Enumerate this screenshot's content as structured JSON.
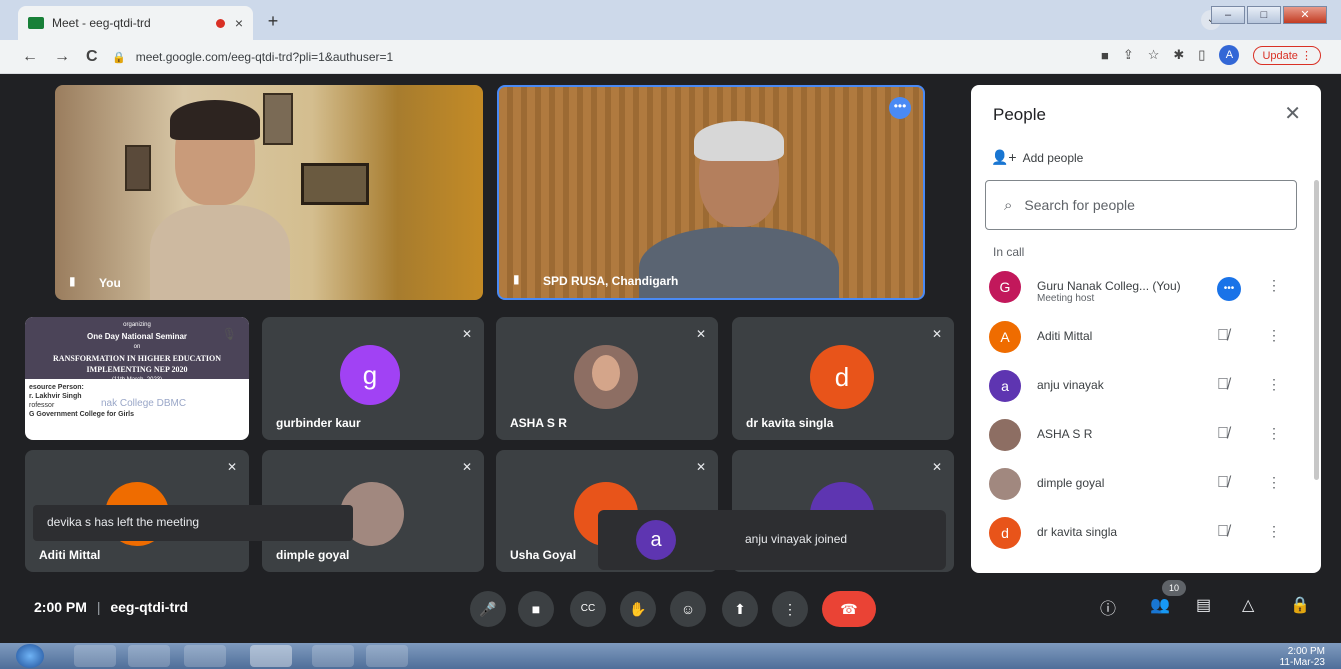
{
  "browser": {
    "tab_title": "Meet - eeg-qtdi-trd",
    "tab_close": "×",
    "new_tab": "+",
    "url": "meet.google.com/eeg-qtdi-trd?pli=1&authuser=1",
    "profile_letter": "A",
    "update_label": "Update",
    "nav": {
      "back": "←",
      "forward": "→",
      "reload": "C"
    }
  },
  "tiles": {
    "you": "You",
    "spd": "SPD RUSA, Chandigarh",
    "gurbinder": {
      "name": "gurbinder kaur",
      "letter": "g",
      "color": "#a142f4"
    },
    "asha": {
      "name": "ASHA S R"
    },
    "kavita": {
      "name": "dr kavita singla",
      "letter": "d",
      "color": "#e8541a"
    },
    "aditi": {
      "name": "Aditi Mittal"
    },
    "dimple": {
      "name": "dimple goyal"
    },
    "usha": {
      "name": "Usha Goyal"
    },
    "slide": {
      "organizing": "organizing",
      "title": "One Day National Seminar",
      "on": "on",
      "topic1": "RANSFORMATION IN HIGHER EDUCATION",
      "topic2": "IMPLEMENTING NEP 2020",
      "date": "(11th March, 2023)",
      "rp_label": "esource Person:",
      "rp_name": "r. Lakhvir Singh",
      "rp_title": "rofessor",
      "rp_overlay": "nak College DBMC",
      "rp_college": "G Government College for Girls"
    }
  },
  "toasts": {
    "left": "devika s has left the meeting",
    "joined_letter": "a",
    "joined": "anju vinayak joined"
  },
  "people": {
    "title": "People",
    "add": "Add people",
    "search_placeholder": "Search for people",
    "in_call": "In call",
    "list": [
      {
        "name": "Guru Nanak Colleg...",
        "you": "(You)",
        "sub": "Meeting host",
        "letter": "G",
        "color": "#c2185b"
      },
      {
        "name": "Aditi Mittal",
        "letter": "A",
        "color": "#ef6c00"
      },
      {
        "name": "anju vinayak",
        "letter": "a",
        "color": "#5e35b1"
      },
      {
        "name": "ASHA S R",
        "letter": "",
        "color": "#8d6e63"
      },
      {
        "name": "dimple goyal",
        "letter": "",
        "color": "#a1887f"
      },
      {
        "name": "dr kavita singla",
        "letter": "d",
        "color": "#e8541a"
      }
    ]
  },
  "controls": {
    "time": "2:00 PM",
    "code": "eeg-qtdi-trd",
    "separator": "|",
    "participants_count": "10"
  },
  "taskbar": {
    "time": "2:00 PM",
    "date": "11-Mar-23"
  }
}
